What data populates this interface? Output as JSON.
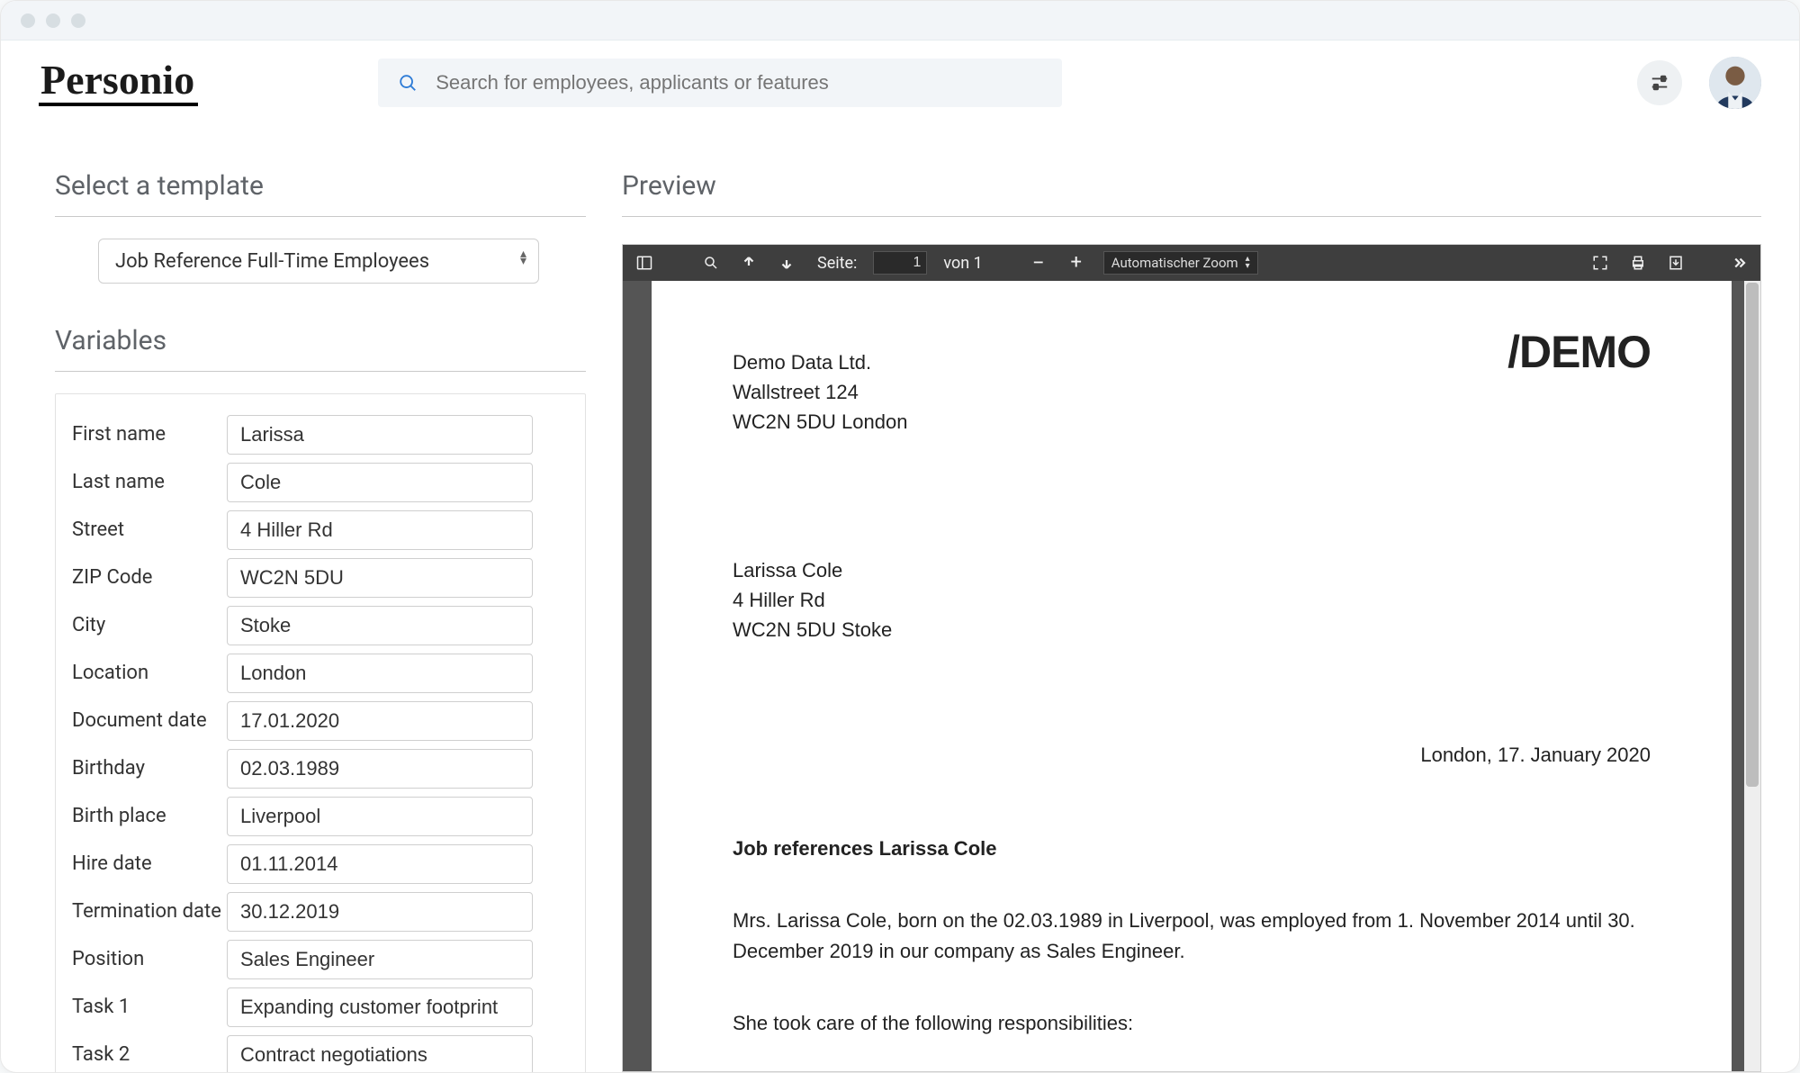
{
  "brand": "Personio",
  "search": {
    "placeholder": "Search for employees, applicants or features"
  },
  "left": {
    "select_section_title": "Select a template",
    "template_select": "Job Reference Full-Time Employees",
    "variables_title": "Variables",
    "rows": [
      {
        "label": "First name",
        "value": "Larissa"
      },
      {
        "label": "Last name",
        "value": "Cole"
      },
      {
        "label": "Street",
        "value": "4 Hiller Rd"
      },
      {
        "label": "ZIP Code",
        "value": "WC2N 5DU"
      },
      {
        "label": "City",
        "value": "Stoke"
      },
      {
        "label": "Location",
        "value": "London"
      },
      {
        "label": "Document date",
        "value": "17.01.2020"
      },
      {
        "label": "Birthday",
        "value": "02.03.1989"
      },
      {
        "label": "Birth place",
        "value": "Liverpool"
      },
      {
        "label": "Hire date",
        "value": "01.11.2014"
      },
      {
        "label": "Termination date",
        "value": "30.12.2019"
      },
      {
        "label": "Position",
        "value": "Sales Engineer"
      },
      {
        "label": "Task 1",
        "value": "Expanding customer footprint"
      },
      {
        "label": "Task 2",
        "value": "Contract negotiations"
      }
    ]
  },
  "preview": {
    "title": "Preview",
    "toolbar": {
      "page_label": "Seite:",
      "page_current": "1",
      "page_total": "von 1",
      "zoom_label": "Automatischer Zoom"
    },
    "page": {
      "demo": "/DEMO",
      "company": [
        "Demo Data Ltd.",
        "Wallstreet 124",
        "WC2N 5DU London"
      ],
      "recipient": [
        "Larissa Cole",
        "4 Hiller Rd",
        "WC2N 5DU Stoke"
      ],
      "dateline": "London, 17. January 2020",
      "subject": "Job references Larissa Cole",
      "body1": "Mrs. Larissa Cole, born on the 02.03.1989 in Liverpool, was employed from 1. November 2014 until 30. December 2019 in our company as Sales Engineer.",
      "body2": "She took care of the following responsibilities:"
    }
  }
}
